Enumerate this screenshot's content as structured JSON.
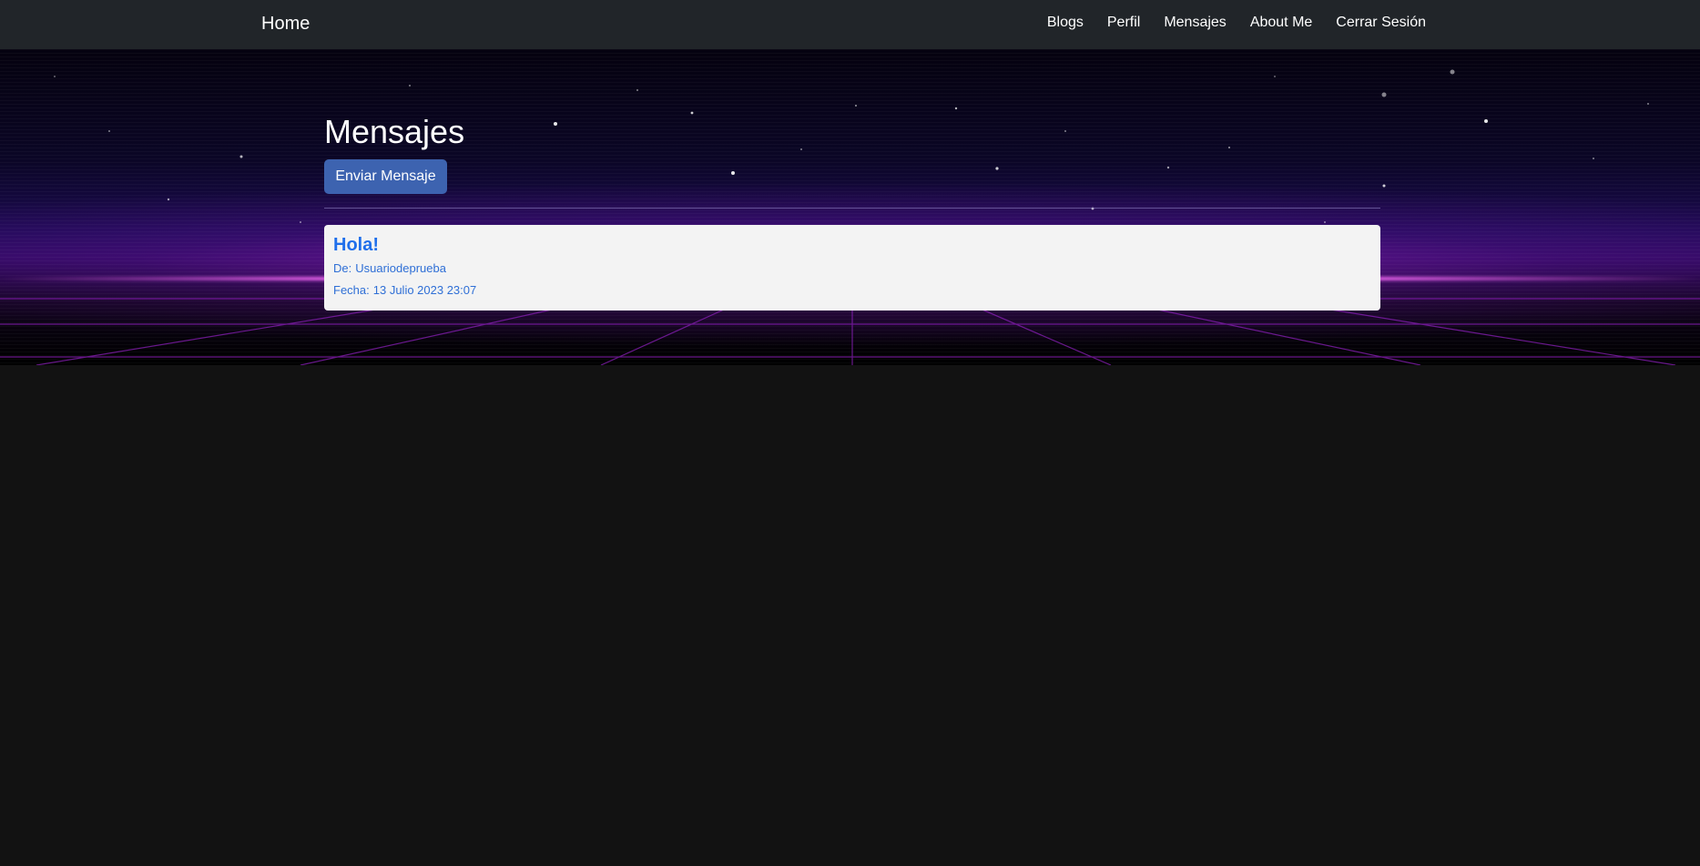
{
  "navbar": {
    "brand": "Home",
    "links": [
      "Blogs",
      "Perfil",
      "Mensajes",
      "About Me",
      "Cerrar Sesión"
    ]
  },
  "page": {
    "title": "Mensajes",
    "send_button": "Enviar Mensaje"
  },
  "messages": [
    {
      "subject": "Hola!",
      "from_label": "De:",
      "from": "Usuariodeprueba",
      "date_label": "Fecha:",
      "date": "13 Julio 2023 23:07"
    }
  ],
  "colors": {
    "navbar_bg": "#212529",
    "page_bg": "#121212",
    "button_bg": "#3d63b0",
    "link_blue": "#1f6feb",
    "card_bg": "#f3f3f3"
  }
}
